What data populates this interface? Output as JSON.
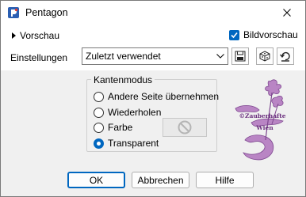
{
  "window": {
    "title": "Pentagon",
    "icon": "paintshop-pro-icon",
    "close": "close-icon"
  },
  "preview": {
    "toggle_label": "Vorschau",
    "bildvorschau_label": "Bildvorschau",
    "bildvorschau_checked": true
  },
  "settings": {
    "label": "Einstellungen",
    "selected": "Zuletzt verwendet",
    "tools": [
      "save-preset-icon",
      "randomize-icon",
      "reset-icon"
    ]
  },
  "edge_mode": {
    "title": "Kantenmodus",
    "options": [
      {
        "label": "Andere Seite übernehmen",
        "selected": false
      },
      {
        "label": "Wiederholen",
        "selected": false
      },
      {
        "label": "Farbe",
        "selected": false
      },
      {
        "label": "Transparent",
        "selected": true
      }
    ]
  },
  "watermark": {
    "line1": "©Zauberhafte",
    "line2": "Wien"
  },
  "buttons": {
    "ok": "OK",
    "cancel": "Abbrechen",
    "help": "Hilfe"
  },
  "colors": {
    "accent": "#0067c0",
    "dialog_bg": "#f0f0f0",
    "watermark": "#9a5aa8"
  }
}
